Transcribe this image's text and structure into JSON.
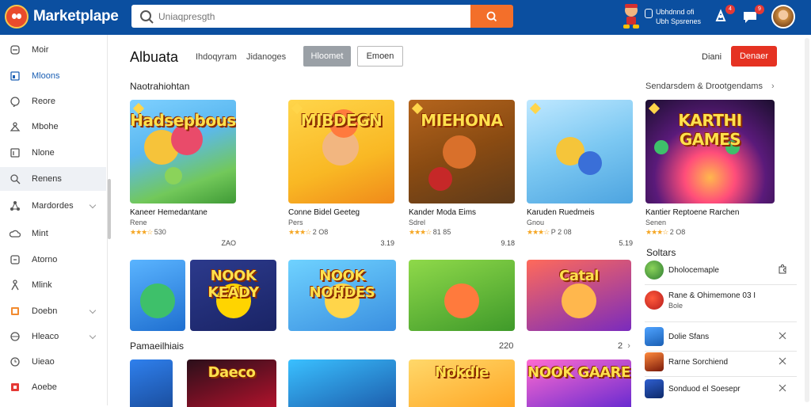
{
  "app": {
    "name": "Marketplape",
    "search_placeholder": "Uniaqpresgth"
  },
  "header": {
    "user_line1": "Ubhdnnd ofi",
    "user_line2": "Ubh Spsrenes",
    "notif_count_1": "4",
    "notif_count_2": "9"
  },
  "sidebar": {
    "items": [
      {
        "label": "Moir",
        "icon": "home-icon"
      },
      {
        "label": "Mloons",
        "icon": "store-icon",
        "active": true
      },
      {
        "label": "Reore",
        "icon": "chat-icon"
      },
      {
        "label": "Mbohe",
        "icon": "user-icon"
      },
      {
        "label": "Nlone",
        "icon": "library-icon"
      },
      {
        "label": "Renens",
        "icon": "search-icon",
        "selected": true
      },
      {
        "label": "Mardordes",
        "icon": "network-icon",
        "chevron": true
      },
      {
        "label": "Mint",
        "icon": "cloud-icon"
      },
      {
        "label": "Atorno",
        "icon": "shield-icon"
      },
      {
        "label": "Mlink",
        "icon": "person-icon"
      },
      {
        "label": "Doebn",
        "icon": "book-icon",
        "chevron": true
      },
      {
        "label": "Hleaco",
        "icon": "globe-icon",
        "chevron": true
      },
      {
        "label": "Uieao",
        "icon": "clock-icon"
      },
      {
        "label": "Aoebe",
        "icon": "gift-icon"
      }
    ]
  },
  "main": {
    "title": "Albuata",
    "crumb_1": "Ihdoqyram",
    "crumb_2": "Jidanoges",
    "btn_gray": "Hloomet",
    "btn_outline": "Emoen",
    "link": "Diani",
    "btn_red": "Denaer",
    "section_1": "Naotrahiohtan",
    "section_1_link": "Sendarsdem & Drootgendams",
    "section_2": "Pamaeilhiais",
    "section_2_count": "220",
    "section_2_page": "2"
  },
  "games": [
    {
      "thumb_title": "Hadsepbous",
      "name": "Kaneer Hemedantane",
      "sub": "Rene",
      "rating": "530",
      "price": "ZAO"
    },
    {
      "thumb_title": "MIBDEGN",
      "name": "Conne Bidel Geeteg",
      "sub": "Pers",
      "rating": "2 O8",
      "price": "3.19"
    },
    {
      "thumb_title": "MIEHONA",
      "name": "Kander Moda Eims",
      "sub": "Sdrel",
      "rating": "81 85",
      "price": "9.18"
    },
    {
      "thumb_title": "",
      "name": "Karuden Ruedmeis",
      "sub": "Gnou",
      "rating": "P 2 08",
      "price": "5.19"
    },
    {
      "thumb_title": "KARTHI GAMES",
      "name": "Kantier Reptoene Rarchen",
      "sub": "Senen",
      "rating": "2 O8",
      "price": ""
    }
  ],
  "row2": [
    {
      "title": ""
    },
    {
      "title": "NOOK KEADY"
    },
    {
      "title": "NOOK NOHDES"
    },
    {
      "title": ""
    },
    {
      "title": "Catal"
    }
  ],
  "row3": [
    {
      "title": ""
    },
    {
      "title": "Daeco"
    },
    {
      "title": ""
    },
    {
      "title": "Nokdle"
    },
    {
      "title": "NOOK GAARE"
    }
  ],
  "right_panel": {
    "title": "Soltars",
    "items": [
      {
        "label": "Dholocemaple"
      },
      {
        "label": "Rane & Ohimemone 03 I",
        "sub": "Bole"
      },
      {
        "label": "Dolie Sfans"
      },
      {
        "label": "Rarne Sorchiend"
      },
      {
        "label": "Sonduod el Soesepr"
      }
    ]
  },
  "colors": {
    "header": "#0b4fa0",
    "accent": "#f36f2a",
    "danger": "#e53222"
  }
}
